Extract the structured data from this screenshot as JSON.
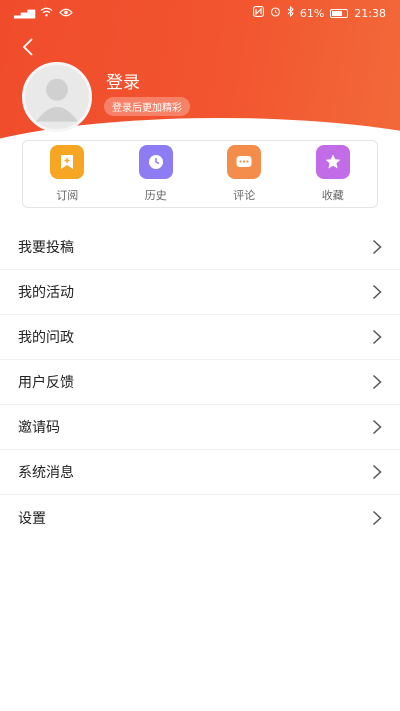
{
  "status_bar": {
    "left_icons": [
      "signal-icon",
      "wifi-icon",
      "eye-icon"
    ],
    "right_icons": [
      "nfc-icon",
      "alarm-icon",
      "bluetooth-icon"
    ],
    "battery": "61%",
    "time": "21:38"
  },
  "colors": {
    "header_start": "#f04c2c",
    "header_end": "#f26a3a",
    "subscribe": "#f6a623",
    "history": "#8e7cf2",
    "comment": "#f48c4c",
    "favorite": "#c36ce8"
  },
  "profile": {
    "login_label": "登录",
    "login_tip": "登录后更加精彩"
  },
  "quick_actions": [
    {
      "label": "订阅",
      "icon": "subscribe-icon"
    },
    {
      "label": "历史",
      "icon": "history-icon"
    },
    {
      "label": "评论",
      "icon": "comment-icon"
    },
    {
      "label": "收藏",
      "icon": "favorite-icon"
    }
  ],
  "menu": [
    {
      "label": "我要投稿"
    },
    {
      "label": "我的活动"
    },
    {
      "label": "我的问政"
    },
    {
      "label": "用户反馈"
    },
    {
      "label": "邀请码"
    },
    {
      "label": "系统消息"
    },
    {
      "label": "设置"
    }
  ]
}
